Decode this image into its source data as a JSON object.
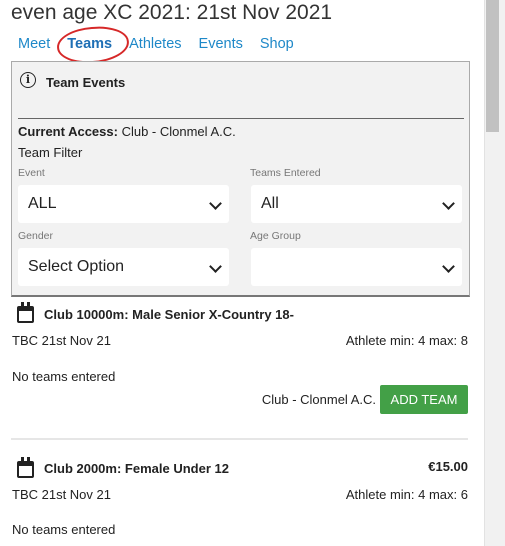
{
  "header": {
    "title": "even age XC 2021: 21st Nov 2021"
  },
  "nav": {
    "items": [
      "Meet",
      "Teams",
      "Athletes",
      "Events",
      "Shop"
    ],
    "active": "Teams"
  },
  "panel": {
    "icon": "info-icon",
    "title": "Team Events",
    "access_label": "Current Access:",
    "access_value": "Club - Clonmel A.C.",
    "filter_title": "Team Filter",
    "event_label": "Event",
    "event_value": "ALL",
    "teams_entered_label": "Teams Entered",
    "teams_entered_value": "All",
    "gender_label": "Gender",
    "gender_value": "Select Option",
    "age_group_label": "Age Group",
    "age_group_value": ""
  },
  "events": [
    {
      "title": "Club 10000m: Male Senior X-Country 18-",
      "price": "",
      "date": "TBC 21st Nov 21",
      "limits": "Athlete min: 4 max: 8",
      "teams": "No teams entered",
      "club": "Club - Clonmel A.C.",
      "button": "ADD TEAM"
    },
    {
      "title": "Club 2000m: Female Under 12",
      "price": "€15.00",
      "date": "TBC 21st Nov 21",
      "limits": "Athlete min: 4 max: 6",
      "teams": "No teams entered"
    }
  ],
  "colors": {
    "accent": "#1e88c8",
    "button": "#43a047",
    "annotation": "#d62828"
  }
}
